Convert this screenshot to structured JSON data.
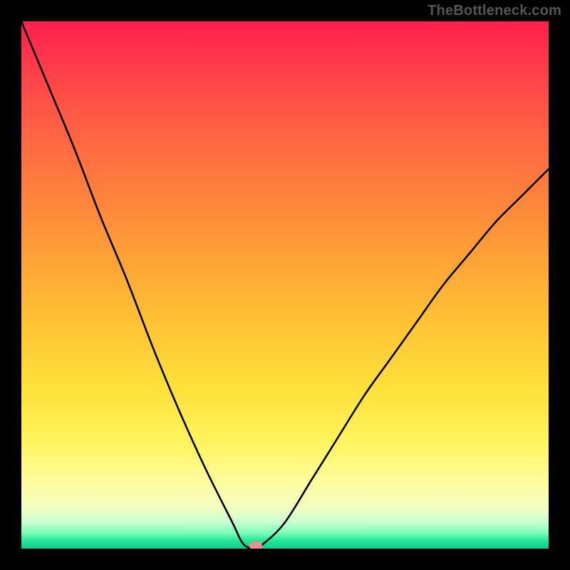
{
  "watermark": "TheBottleneck.com",
  "chart_data": {
    "type": "line",
    "title": "",
    "xlabel": "",
    "ylabel": "",
    "xlim": [
      0,
      100
    ],
    "ylim": [
      0,
      100
    ],
    "x": [
      0,
      5,
      10,
      15,
      20,
      25,
      30,
      35,
      40,
      42,
      44,
      46,
      50,
      55,
      60,
      65,
      70,
      75,
      80,
      85,
      90,
      95,
      100
    ],
    "values": [
      100,
      88,
      76,
      63,
      51,
      38,
      26,
      15,
      5,
      1,
      0,
      1,
      5,
      13,
      21,
      29,
      36,
      43,
      50,
      56,
      62,
      67,
      72
    ],
    "minimum_x": 44,
    "minimum_y": 0,
    "marker": {
      "x": 44.5,
      "y": 0.5,
      "color": "#e98f8d"
    },
    "note": "Two-branch curve plunging to a minimum near x≈44 then rising; values are approximate percentages read off the vertical gradient."
  },
  "colors": {
    "frame_background": "#000000",
    "curve": "#000000",
    "watermark": "#555555",
    "marker": "#e98f8d"
  }
}
